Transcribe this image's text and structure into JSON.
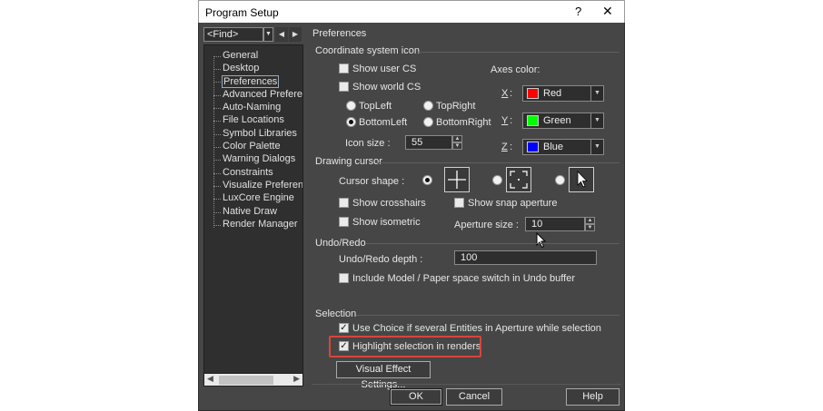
{
  "window": {
    "title": "Program Setup",
    "help_glyph": "?",
    "close_glyph": "✕"
  },
  "sidebar": {
    "find_value": "<Find>",
    "items": [
      {
        "label": "General"
      },
      {
        "label": "Desktop"
      },
      {
        "label": "Preferences",
        "selected": true
      },
      {
        "label": "Advanced Preferences"
      },
      {
        "label": "Auto-Naming"
      },
      {
        "label": "File Locations"
      },
      {
        "label": "Symbol Libraries"
      },
      {
        "label": "Color Palette"
      },
      {
        "label": "Warning Dialogs"
      },
      {
        "label": "Constraints"
      },
      {
        "label": "Visualize Preferences"
      },
      {
        "label": "LuxCore Engine"
      },
      {
        "label": "Native Draw"
      },
      {
        "label": "Render Manager"
      }
    ]
  },
  "page_title": "Preferences",
  "coord_icon": {
    "group_label": "Coordinate system icon",
    "show_user_cs": {
      "label": "Show user CS",
      "checked": false
    },
    "show_world_cs": {
      "label": "Show world CS",
      "checked": false
    },
    "positions": {
      "topleft": {
        "label": "TopLeft",
        "selected": false
      },
      "topright": {
        "label": "TopRight",
        "selected": false
      },
      "bottomleft": {
        "label": "BottomLeft",
        "selected": true
      },
      "bottomright": {
        "label": "BottomRight",
        "selected": false
      }
    },
    "icon_size_label": "Icon size :",
    "icon_size_value": "55",
    "axes_color_label": "Axes color:",
    "axes": {
      "x": {
        "label": "X",
        "sep": ":",
        "color_name": "Red",
        "color": "#ff0000"
      },
      "y": {
        "label": "Y",
        "sep": ":",
        "color_name": "Green",
        "color": "#00ff00"
      },
      "z": {
        "label": "Z",
        "sep": ":",
        "color_name": "Blue",
        "color": "#0000ff"
      }
    }
  },
  "drawing_cursor": {
    "group_label": "Drawing cursor",
    "cursor_shape_label": "Cursor shape :",
    "cursor_options": [
      {
        "icon": "crosshair-icon",
        "selected": true
      },
      {
        "icon": "corner-brackets-icon",
        "selected": false
      },
      {
        "icon": "arrow-pointer-icon",
        "selected": false
      }
    ],
    "show_crosshairs": {
      "label": "Show crosshairs",
      "checked": false
    },
    "show_snap_aperture": {
      "label": "Show snap aperture",
      "checked": false
    },
    "show_isometric": {
      "label": "Show isometric",
      "checked": false
    },
    "aperture_size_label": "Aperture size :",
    "aperture_size_value": "10"
  },
  "undo_redo": {
    "group_label": "Undo/Redo",
    "depth_label": "Undo/Redo depth :",
    "depth_value": "100",
    "include_switch": {
      "label": "Include Model / Paper space switch in Undo buffer",
      "checked": false
    }
  },
  "selection": {
    "group_label": "Selection",
    "use_choice": {
      "label": "Use Choice if several Entities in Aperture while selection",
      "checked": true
    },
    "highlight_renders": {
      "label": "Highlight selection in renders",
      "checked": true
    },
    "visual_effect_button": "Visual Effect Settings..."
  },
  "footer": {
    "ok": "OK",
    "cancel": "Cancel",
    "help": "Help"
  },
  "colors": {
    "highlight_box": "#d9443c",
    "dialog_bg": "#464646"
  }
}
